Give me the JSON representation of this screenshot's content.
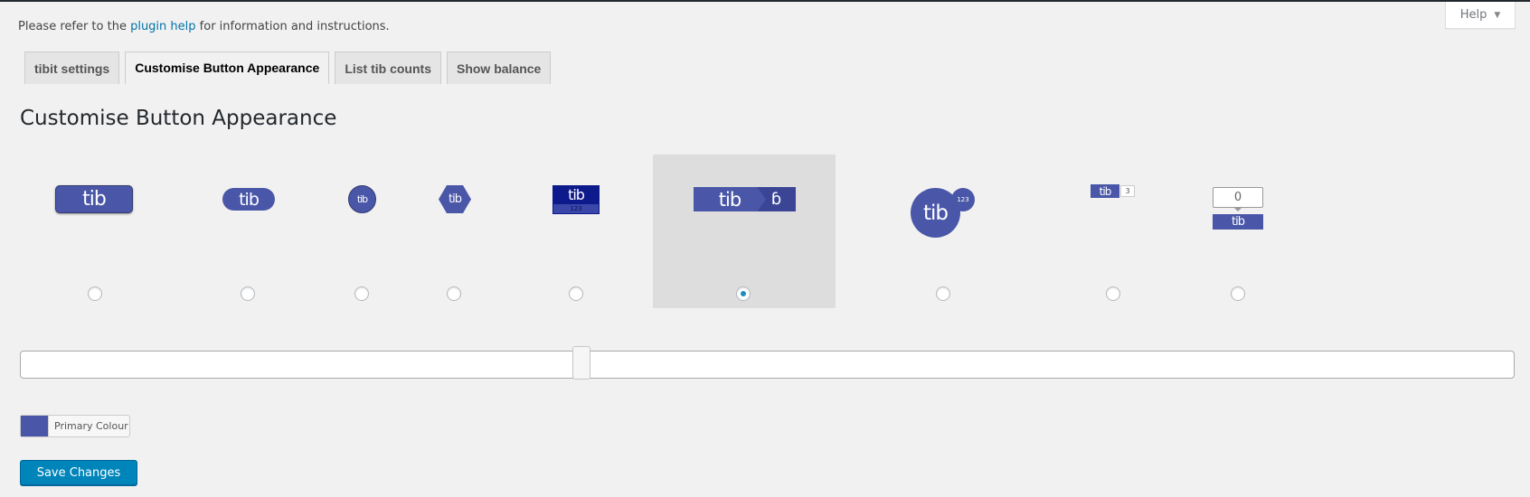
{
  "notice": {
    "prefix": "Please refer to the ",
    "link": "plugin help",
    "suffix": " for information and instructions."
  },
  "help": {
    "label": "Help"
  },
  "tabs": [
    {
      "label": "tibit settings",
      "active": false
    },
    {
      "label": "Customise Button Appearance",
      "active": true
    },
    {
      "label": "List tib counts",
      "active": false
    },
    {
      "label": "Show balance",
      "active": false
    }
  ],
  "title": "Customise Button Appearance",
  "buttons": {
    "tib": "tib",
    "count_small": "3",
    "count_circle": "123",
    "count_square": "123",
    "count_bubble": "0",
    "selected_index": 5
  },
  "colour": {
    "label": "Primary Colour",
    "value": "#4a57a8"
  },
  "save": {
    "label": "Save Changes"
  },
  "slider": {
    "value_fraction": 0.37
  }
}
